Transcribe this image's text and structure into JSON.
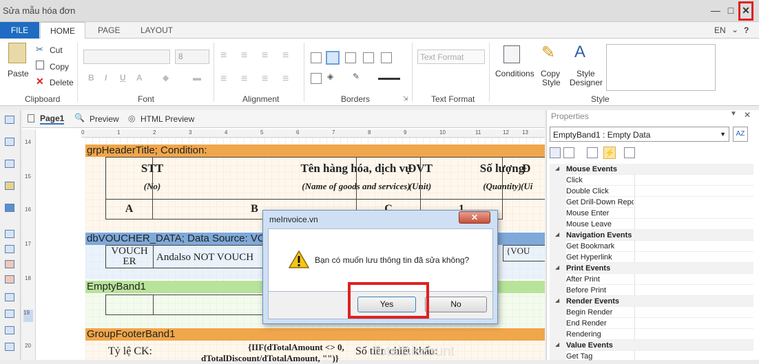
{
  "window": {
    "title": "Sửa mẫu hóa đơn",
    "min_icon": "minimize-icon",
    "max_icon": "maximize-icon",
    "close_icon": "close-icon"
  },
  "tabs": {
    "file": "FILE",
    "home": "HOME",
    "page": "PAGE",
    "layout": "LAYOUT",
    "lang": "EN",
    "help": "?"
  },
  "ribbon": {
    "clipboard": {
      "label": "Clipboard",
      "paste": "Paste",
      "cut": "Cut",
      "copy": "Copy",
      "delete": "Delete"
    },
    "font": {
      "label": "Font",
      "size": "8"
    },
    "alignment": {
      "label": "Alignment"
    },
    "borders": {
      "label": "Borders"
    },
    "text_format": {
      "label": "Text Format",
      "value": "Text Format"
    },
    "style": {
      "label": "Style",
      "conditions": "Conditions",
      "copy_style_1": "Copy",
      "copy_style_2": "Style",
      "style_designer_1": "Style",
      "style_designer_2": "Designer"
    }
  },
  "designer": {
    "tabs": {
      "page1": "Page1",
      "preview": "Preview",
      "html_preview": "HTML Preview"
    },
    "ruler_top": [
      "0",
      "1",
      "2",
      "3",
      "4",
      "5",
      "6",
      "7",
      "8",
      "9",
      "10",
      "11",
      "12",
      "13"
    ],
    "ruler_left": [
      "14",
      "15",
      "16",
      "17",
      "18",
      "19",
      "20"
    ],
    "bands": {
      "header": "grpHeaderTitle; Condition:",
      "data": "dbVOUCHER_DATA; Data Source: VOU",
      "empty": "EmptyBand1",
      "footer": "GroupFooterBand1"
    },
    "table": {
      "stt": "STT",
      "stt_en": "(No)",
      "stt_col": "A",
      "name": "Tên hàng hóa, dịch vụ",
      "name_en": "(Name of goods and services)",
      "name_col": "B",
      "unit": "ĐVT",
      "unit_en": "(Unit)",
      "unit_col": "C",
      "qty": "Số lượng",
      "qty_en": "(Quantity)",
      "qty_col": "1",
      "next": "Đ",
      "next_en": "(Ui"
    },
    "data_cells": {
      "voucher": "VOUCH ER",
      "andalso": "Andalso NOT VOUCH",
      "right": "{VOU"
    },
    "footer_cells": {
      "rate": "Tỷ lệ CK:",
      "expr1": "{IIF(dTotalAmount <> 0,",
      "expr2": "dTotalDiscount/dTotalAmount, \"\")}",
      "discount": "Số tiền chiết khấu:",
      "ghost": "TotalDiscount"
    }
  },
  "properties": {
    "title": "Properties",
    "selector": "EmptyBand1 : Empty Data",
    "groups": [
      {
        "name": "Mouse Events",
        "items": [
          "Click",
          "Double Click",
          "Get Drill-Down Repo",
          "Mouse Enter",
          "Mouse Leave"
        ]
      },
      {
        "name": "Navigation Events",
        "items": [
          "Get Bookmark",
          "Get Hyperlink"
        ]
      },
      {
        "name": "Print Events",
        "items": [
          "After Print",
          "Before Print"
        ]
      },
      {
        "name": "Render Events",
        "items": [
          "Begin Render",
          "End Render",
          "Rendering"
        ]
      },
      {
        "name": "Value Events",
        "items": [
          "Get Tag"
        ]
      }
    ]
  },
  "dialog": {
    "title": "meInvoice.vn",
    "message": "Bạn có muốn lưu thông tin đã sửa không?",
    "yes": "Yes",
    "no": "No",
    "icon": "warning-icon"
  },
  "colors": {
    "header_band": "#f0a64a",
    "data_band": "#7ea9d9",
    "empty_band": "#b8e39a",
    "footer_band": "#f0a64a",
    "file_tab": "#1f6cc2",
    "highlight": "#e02020"
  }
}
